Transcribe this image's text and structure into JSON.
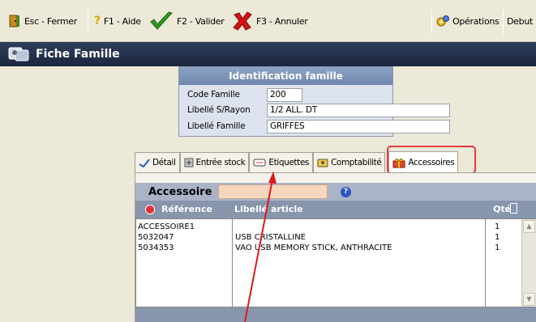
{
  "toolbar": {
    "close_label": "Esc - Fermer",
    "help_label": "F1 - Aide",
    "validate_label": "F2 - Valider",
    "cancel_label": "F3 - Annuler",
    "operations_label": "Opérations",
    "debut_label": "Debut"
  },
  "window": {
    "title": "Fiche Famille"
  },
  "identification": {
    "header": "Identification famille",
    "fields": [
      {
        "label": "Code Famille",
        "value": "200"
      },
      {
        "label": "Libellé S/Rayon",
        "value": "1/2 ALL. DT"
      },
      {
        "label": "Libellé Famille",
        "value": "GRIFFES"
      }
    ]
  },
  "tabs": [
    {
      "label": "Détail",
      "icon": "detail-icon"
    },
    {
      "label": "Entrée stock",
      "icon": "stock-icon"
    },
    {
      "label": "Etiquettes",
      "icon": "label-tag-icon"
    },
    {
      "label": "Comptabilité",
      "icon": "accounting-icon"
    },
    {
      "label": "Accessoires",
      "icon": "gift-icon",
      "active": true
    }
  ],
  "accessories": {
    "field_label": "Accessoire",
    "field_value": "",
    "columns": {
      "reference": "Référence",
      "libelle": "Libellé article",
      "qty": "Qté"
    },
    "rows": [
      {
        "reference": "ACCESSOIRE1",
        "libelle": "",
        "qty": "1"
      },
      {
        "reference": "5032047",
        "libelle": "USB CRISTALLINE",
        "qty": "1"
      },
      {
        "reference": "5034353",
        "libelle": "VAO USB MEMORY STICK, ANTHRACITE",
        "qty": "1"
      }
    ]
  },
  "colors": {
    "highlight": "#e03c3c",
    "grid_header": "#8795ad",
    "title_bar": "#1c2740"
  }
}
